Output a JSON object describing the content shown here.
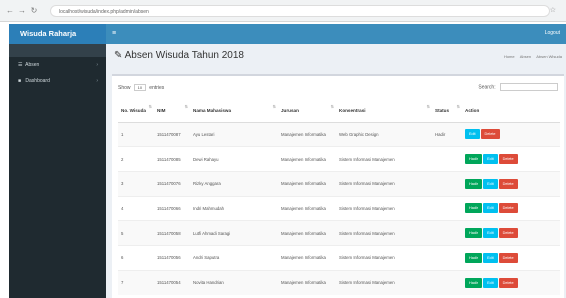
{
  "browser": {
    "url": "localhost/wisuda/index.php/admin/absen"
  },
  "sidebar": {
    "brand": "Wisuda Raharja",
    "items": [
      {
        "icon": "☰",
        "label": "Absen"
      },
      {
        "icon": "■",
        "label": "Dashboard"
      }
    ]
  },
  "topbar": {
    "logout": "Logout"
  },
  "page": {
    "title": "Absen Wisuda Tahun 2018",
    "breadcrumbs": [
      "Home",
      "Absen",
      "Absen Wisuda"
    ]
  },
  "controls": {
    "show_label": "Show",
    "show_value": "10",
    "entries_label": "entries",
    "search_label": "Search:"
  },
  "table": {
    "headers": [
      "No. Wisuda",
      "NIM",
      "Nama Mahasiswa",
      "Jurusan",
      "Konsentrasi",
      "Status",
      "Action"
    ],
    "rows": [
      {
        "no": "1",
        "nim": "1511470087",
        "nama": "Ayu Lestari",
        "jurusan": "Manajemen Informatika",
        "konsentrasi": "Web Graphic Design",
        "status": "Hadir",
        "buttons": [
          "Edit",
          "Delete"
        ]
      },
      {
        "no": "2",
        "nim": "1511470085",
        "nama": "Dewi Rahayu",
        "jurusan": "Manajemen Informatika",
        "konsentrasi": "Sistem Informasi Manajemen",
        "status": "",
        "buttons": [
          "Hadir",
          "Edit",
          "Delete"
        ]
      },
      {
        "no": "3",
        "nim": "1511470076",
        "nama": "Rizky Anggara",
        "jurusan": "Manajemen Informatika",
        "konsentrasi": "Sistem Informasi Manajemen",
        "status": "",
        "buttons": [
          "Hadir",
          "Edit",
          "Delete"
        ]
      },
      {
        "no": "4",
        "nim": "1511470066",
        "nama": "Indri Mahmudah",
        "jurusan": "Manajemen Informatika",
        "konsentrasi": "Sistem Informasi Manajemen",
        "status": "",
        "buttons": [
          "Hadir",
          "Edit",
          "Delete"
        ]
      },
      {
        "no": "5",
        "nim": "1511470058",
        "nama": "Lutfi Ahmadi Saragi",
        "jurusan": "Manajemen Informatika",
        "konsentrasi": "Sistem Informasi Manajemen",
        "status": "",
        "buttons": [
          "Hadir",
          "Edit",
          "Delete"
        ]
      },
      {
        "no": "6",
        "nim": "1511470056",
        "nama": "Andri Saputra",
        "jurusan": "Manajemen Informatika",
        "konsentrasi": "Sistem Informasi Manajemen",
        "status": "",
        "buttons": [
          "Hadir",
          "Edit",
          "Delete"
        ]
      },
      {
        "no": "7",
        "nim": "1511470054",
        "nama": "Novita Handrian",
        "jurusan": "Manajemen Informatika",
        "konsentrasi": "Sistem Informasi Manajemen",
        "status": "",
        "buttons": [
          "Hadir",
          "Edit",
          "Delete"
        ]
      }
    ]
  },
  "colors": {
    "header_blue": "#3c8dbc",
    "brand_blue": "#2c7fb8",
    "sidebar_dark": "#1f2a30",
    "green": "#00a65a",
    "cyan": "#00c0ef",
    "red": "#dd4b39"
  },
  "icons": [
    "back-icon",
    "forward-icon",
    "reload-icon",
    "bookmark-icon",
    "menu-toggle-icon",
    "edit-icon",
    "sort-icon"
  ]
}
